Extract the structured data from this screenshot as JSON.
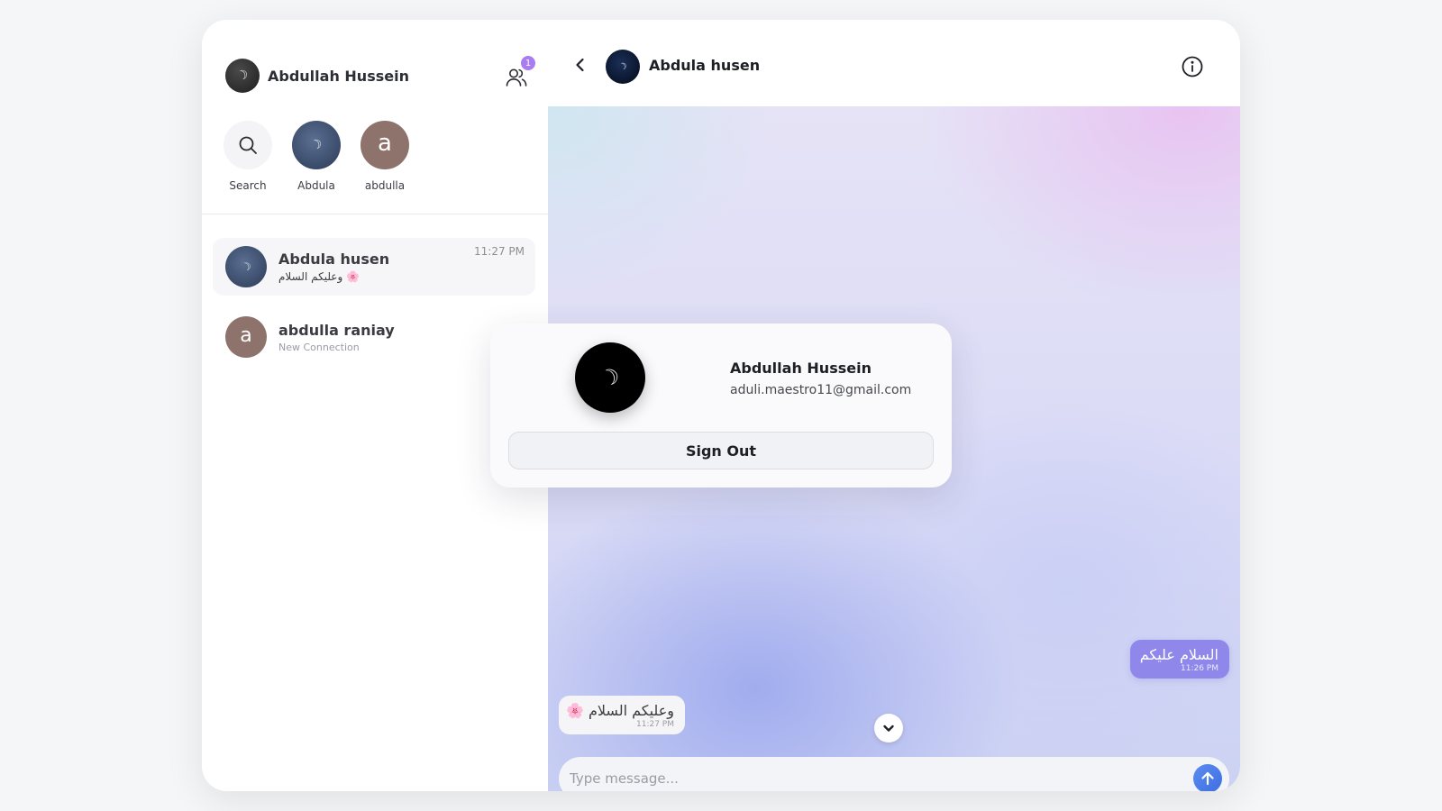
{
  "current_user": {
    "name": "Abdullah Hussein",
    "email": "aduli.maestro11@gmail.com",
    "avatar_glyph": "☽"
  },
  "header_actions": {
    "people_icon": "users-icon",
    "notification_count": "1"
  },
  "stories": [
    {
      "label": "Search",
      "icon": "search-icon"
    },
    {
      "label": "Abdula",
      "glyph": "☽"
    },
    {
      "label": "abdulla",
      "initial": "a"
    }
  ],
  "chats": [
    {
      "name": "Abdula husen",
      "preview": "وعليكم السلام 🌸",
      "time": "11:27 PM",
      "glyph": "☽",
      "active": true
    },
    {
      "name": "abdulla raniay",
      "preview": "New Connection",
      "initial": "a",
      "active": false
    }
  ],
  "conversation": {
    "contact_name": "Abdula husen",
    "contact_glyph": "☽",
    "messages": [
      {
        "direction": "out",
        "text": "السلام عليكم",
        "time": "11:26 PM"
      },
      {
        "direction": "in",
        "text": "وعليكم السلام 🌸",
        "time": "11:27 PM"
      }
    ],
    "composer_placeholder": "Type message..."
  },
  "profile_popup": {
    "name": "Abdullah Hussein",
    "email": "aduli.maestro11@gmail.com",
    "sign_out_label": "Sign Out"
  },
  "colors": {
    "accent": "#a97cf0",
    "outgoing_bubble": "#8f88ea",
    "send_button": "#4a7ae8",
    "brown_avatar": "#8d736c"
  }
}
